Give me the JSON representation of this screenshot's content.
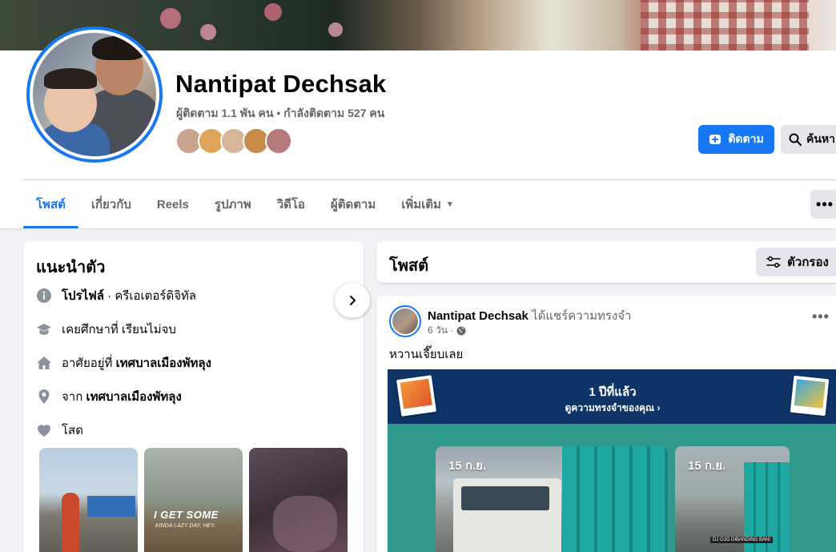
{
  "profile": {
    "name": "Nantipat Dechsak",
    "stats": "ผู้ติดตาม 1.1 พัน คน • กำลังติดตาม 527 คน",
    "follow_label": "ติดตาม",
    "search_label": "ค้นหา",
    "friend_colors": [
      "#c9a38e",
      "#e0a35a",
      "#d8b69a",
      "#c98a4a",
      "#b77a7a"
    ]
  },
  "tabs": [
    {
      "label": "โพสต์"
    },
    {
      "label": "เกี่ยวกับ"
    },
    {
      "label": "Reels"
    },
    {
      "label": "รูปภาพ"
    },
    {
      "label": "วิดีโอ"
    },
    {
      "label": "ผู้ติดตาม"
    },
    {
      "label": "เพิ่มเติม"
    }
  ],
  "more_menu_icon": "ellipsis-icon",
  "intro": {
    "title": "แนะนำตัว",
    "items": [
      {
        "icon": "info-icon",
        "bold": "โปรไฟล์",
        "text": " · ครีเอเตอร์ดิจิทัล"
      },
      {
        "icon": "graduation-cap-icon",
        "bold": "",
        "text": "เคยศึกษาที่ เรียนไม่จบ"
      },
      {
        "icon": "home-icon",
        "bold": "เทศบาลเมืองพัทลุง",
        "text": "อาศัยอยู่ที่ "
      },
      {
        "icon": "location-pin-icon",
        "bold": "เทศบาลเมืองพัทลุง",
        "text": "จาก "
      },
      {
        "icon": "heart-icon",
        "bold": "",
        "text": "โสด"
      }
    ],
    "thumb2_title": "I GET SOME",
    "thumb2_sub": "KINDA LAZY DAY, HEY."
  },
  "posts": {
    "title": "โพสต์",
    "filter_label": "ตัวกรอง"
  },
  "post": {
    "author": "Nantipat Dechsak",
    "action": " ได้แชร์ความทรงจำ",
    "time": "6 วัน ·",
    "text": "หวานเจี๊ยบเลย",
    "memory_year": "1 ปีที่แล้ว",
    "memory_link": "ดูความทรงจำของคุณ",
    "photo1_date": "15 ก.ย.",
    "photo2_date": "15 ก.ย.",
    "photo2_caption": "DJ OJO DIBANDING BANI"
  },
  "colors": {
    "accent": "#1877f2",
    "memory_bg": "#0f3468",
    "memory_teal": "#2f9a8c"
  }
}
